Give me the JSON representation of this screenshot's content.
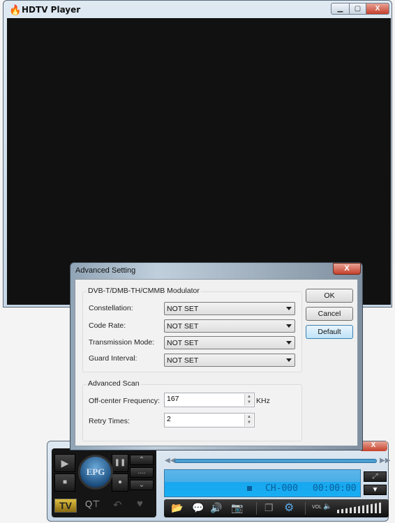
{
  "main_window": {
    "title": "HDTV Player",
    "icons": {
      "logo": "flame-logo",
      "minimize": "minimize-icon",
      "maximize": "maximize-icon",
      "close": "close-icon"
    }
  },
  "dialog": {
    "title": "Advanced Setting",
    "modulator": {
      "title": "DVB-T/DMB-TH/CMMB Modulator",
      "fields": [
        {
          "label": "Constellation:",
          "value": "NOT SET"
        },
        {
          "label": "Code Rate:",
          "value": "NOT SET"
        },
        {
          "label": "Transmission Mode:",
          "value": "NOT SET"
        },
        {
          "label": "Guard Interval:",
          "value": "NOT SET"
        }
      ]
    },
    "scan": {
      "title": "Advanced Scan",
      "frequency_label": "Off-center Frequency:",
      "frequency_value": "167",
      "frequency_unit": "KHz",
      "retry_label": "Retry Times:",
      "retry_value": "2"
    },
    "buttons": {
      "ok": "OK",
      "cancel": "Cancel",
      "default": "Default"
    }
  },
  "player": {
    "epg": "EPG",
    "tv": "TV",
    "channel": "CH-000",
    "time": "00:00:00",
    "vol_label": "VOL",
    "dots": "...."
  }
}
